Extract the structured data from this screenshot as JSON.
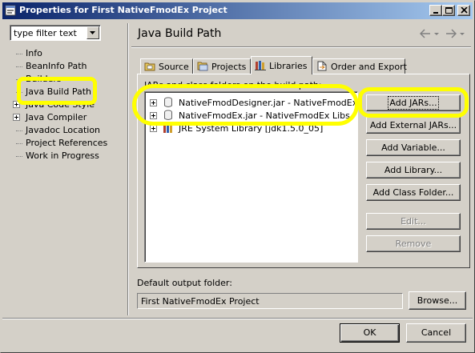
{
  "window": {
    "title": "Properties for First NativeFmodEx Project"
  },
  "filter": {
    "value": "type filter text"
  },
  "sidebar": {
    "items": [
      {
        "label": "Info",
        "expandable": false
      },
      {
        "label": "BeanInfo Path",
        "expandable": false
      },
      {
        "label": "Builders",
        "expandable": false
      },
      {
        "label": "Java Build Path",
        "expandable": false
      },
      {
        "label": "Java Code Style",
        "expandable": true
      },
      {
        "label": "Java Compiler",
        "expandable": true
      },
      {
        "label": "Javadoc Location",
        "expandable": false
      },
      {
        "label": "Project References",
        "expandable": false
      },
      {
        "label": "Work in Progress",
        "expandable": false
      }
    ]
  },
  "page": {
    "title": "Java Build Path",
    "tabs": [
      {
        "label": "Source",
        "active": false
      },
      {
        "label": "Projects",
        "active": false
      },
      {
        "label": "Libraries",
        "active": true
      },
      {
        "label": "Order and Export",
        "active": false
      }
    ],
    "jars_label": "JARs and class folders on the build path:",
    "libraries": [
      {
        "label": "NativeFmodDesigner.jar - NativeFmodEx Libs",
        "icon": "jar-icon"
      },
      {
        "label": "NativeFmodEx.jar - NativeFmodEx Libs",
        "icon": "jar-icon"
      },
      {
        "label": "JRE System Library [jdk1.5.0_05]",
        "icon": "library-icon"
      }
    ],
    "buttons": {
      "add_jars": "Add JARs...",
      "add_external_jars": "Add External JARs...",
      "add_variable": "Add Variable...",
      "add_library": "Add Library...",
      "add_class_folder": "Add Class Folder...",
      "edit": "Edit...",
      "remove": "Remove"
    },
    "output_folder_label": "Default output folder:",
    "output_folder_value": "First NativeFmodEx Project",
    "browse": "Browse..."
  },
  "footer": {
    "ok": "OK",
    "cancel": "Cancel"
  },
  "annotations": {
    "highlight_color": "#ffff00"
  }
}
